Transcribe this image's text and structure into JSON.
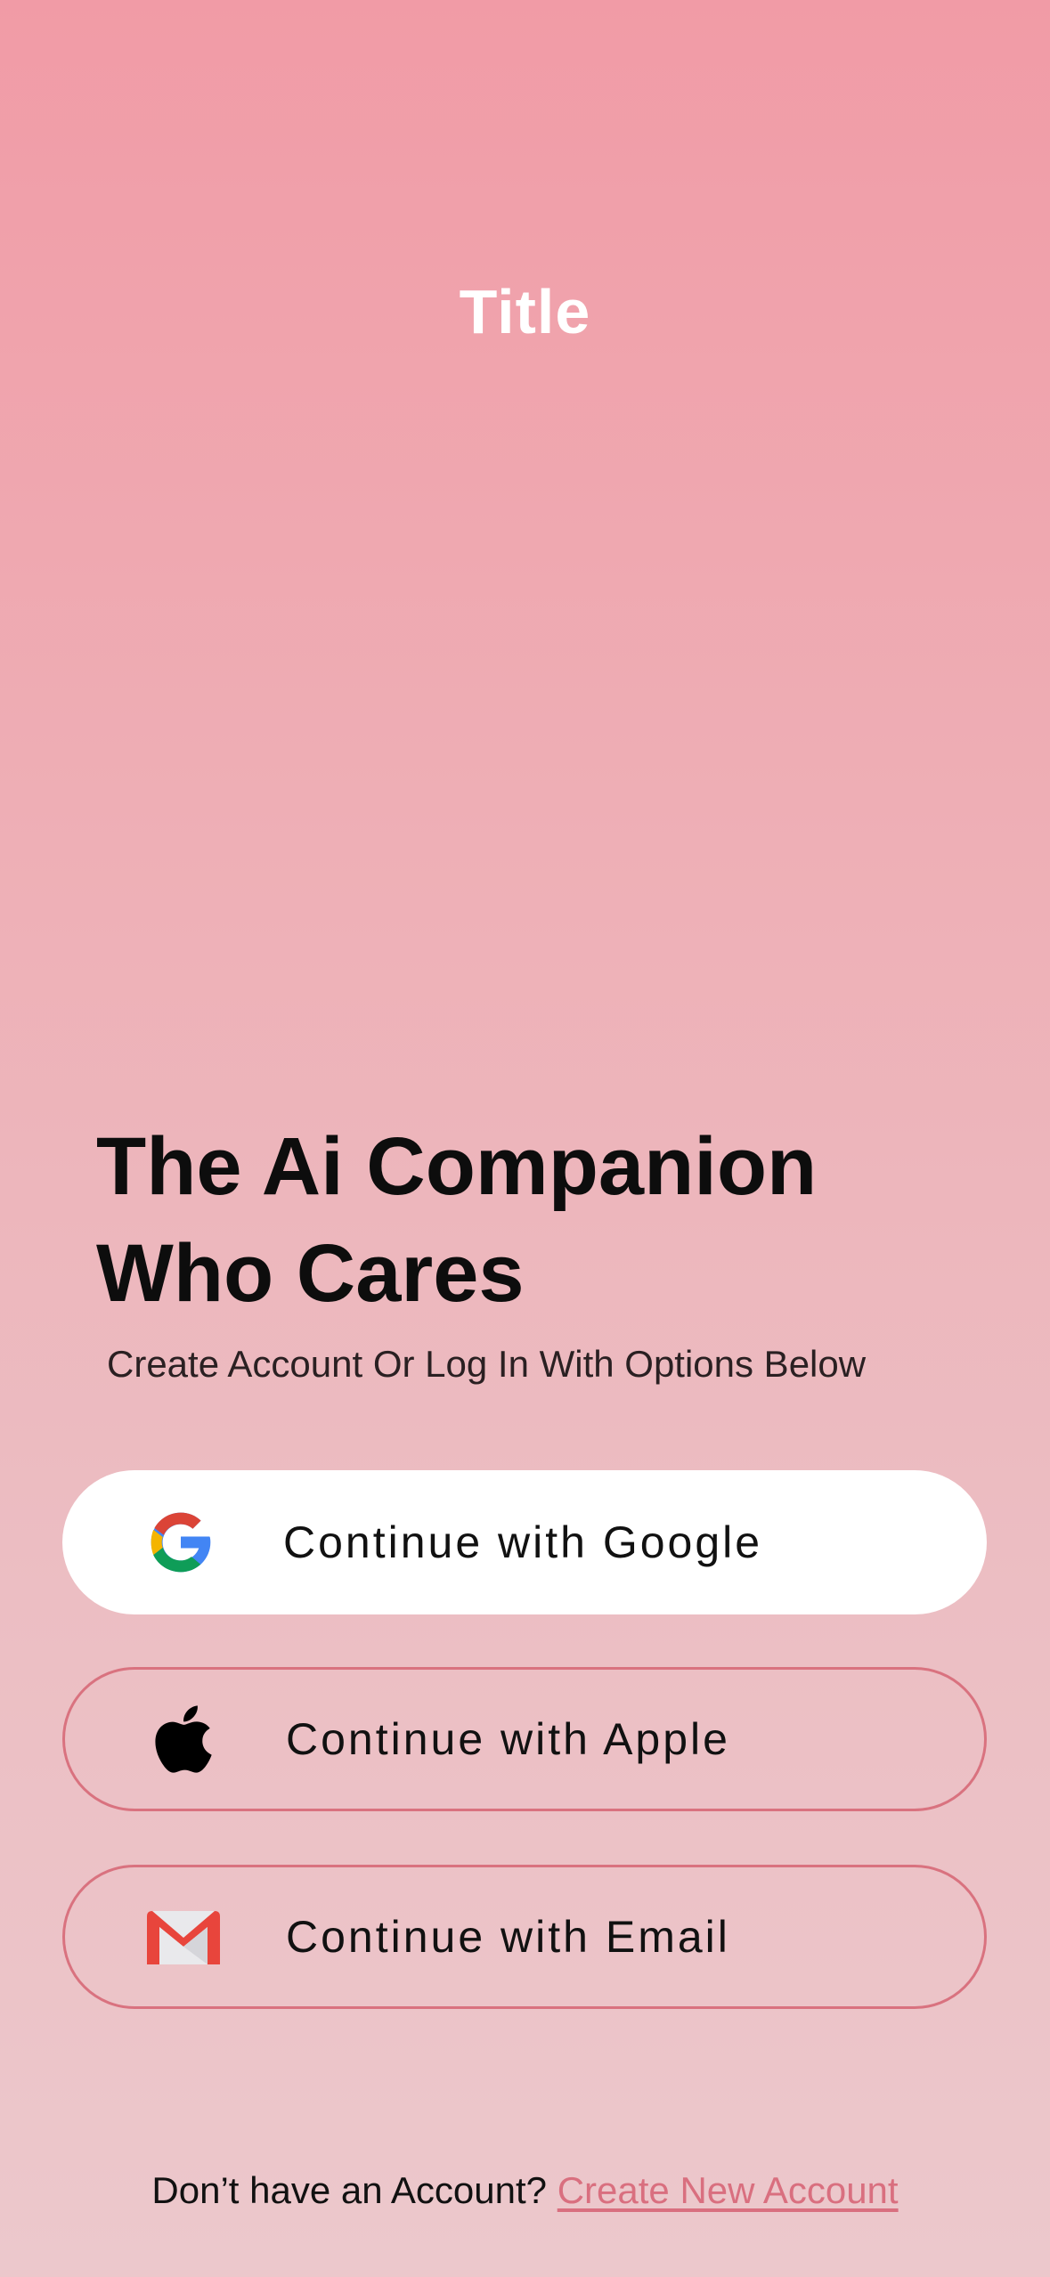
{
  "header": {
    "title": "Title"
  },
  "hero": {
    "headline_line1": "The Ai Companion",
    "headline_line2": "Who Cares",
    "subheadline": "Create Account Or Log In With Options Below"
  },
  "auth_options": {
    "google": {
      "label": "Continue with Google",
      "icon": "google-icon"
    },
    "apple": {
      "label": "Continue with Apple",
      "icon": "apple-icon"
    },
    "email": {
      "label": "Continue with Email",
      "icon": "gmail-icon"
    }
  },
  "footer": {
    "prompt": "Don’t have an Account?",
    "link": "Create New Account"
  },
  "colors": {
    "background_top": "#f19ba6",
    "background_bottom": "#ecc8cc",
    "accent": "#d96f7f",
    "button_border": "#d9727f"
  }
}
